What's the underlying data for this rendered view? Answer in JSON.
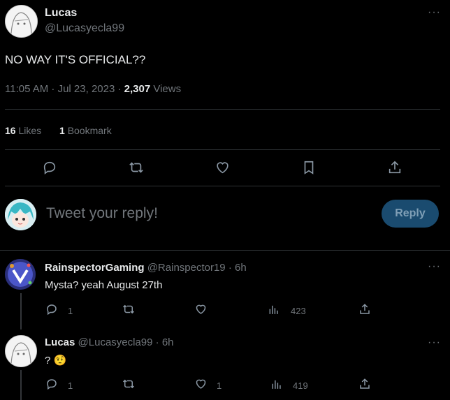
{
  "tweet": {
    "author_name": "Lucas",
    "author_handle": "@Lucasyecla99",
    "text": "NO WAY IT'S OFFICIAL??",
    "time": "11:05 AM · Jul 23, 2023 · ",
    "views_count": "2,307",
    "views_label": " Views",
    "likes_count": "16",
    "likes_label": "Likes",
    "bookmarks_count": "1",
    "bookmarks_label": "Bookmark"
  },
  "composer": {
    "placeholder": "Tweet your reply!",
    "button_label": "Reply"
  },
  "replies": [
    {
      "name": "RainspectorGaming",
      "handle": "@Rainspector19",
      "time": "· 6h",
      "text": "Mysta? yeah August 27th",
      "replies": "1",
      "likes": "",
      "views": "423"
    },
    {
      "name": "Lucas",
      "handle": "@Lucasyecla99",
      "time": "· 6h",
      "text": "?",
      "emoji": "🤨",
      "replies": "1",
      "likes": "1",
      "views": "419"
    }
  ],
  "icons": {
    "more": "more-icon",
    "reply": "reply-icon",
    "retweet": "retweet-icon",
    "like": "heart-icon",
    "bookmark": "bookmark-icon",
    "share": "share-icon",
    "views": "views-icon"
  },
  "colors": {
    "background": "#000000",
    "text": "#e7e9ea",
    "muted": "#71767b",
    "divider": "#2f3336",
    "reply_button": "#1a4b6f"
  }
}
